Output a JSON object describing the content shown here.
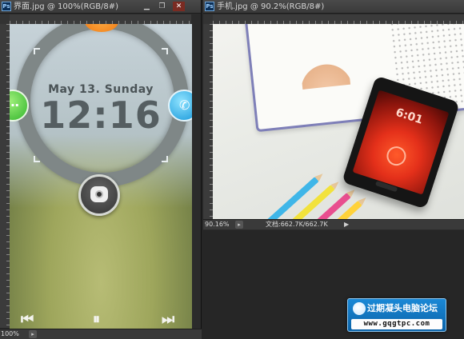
{
  "left_window": {
    "ps_badge": "Ps",
    "title": "界面.jpg @ 100%(RGB/8#)",
    "btn_minimize": "▁",
    "btn_restore": "❐",
    "btn_close": "✕",
    "lock_screen": {
      "date": "May 13.  Sunday",
      "time": "12:16",
      "media_prev": "⏮",
      "media_pause": "⏸",
      "media_next": "⏭"
    },
    "status": {
      "zoom": "100%",
      "nav_icon": "▸"
    }
  },
  "right_window": {
    "ps_badge": "Ps",
    "title": "手机.jpg @ 90.2%(RGB/8#)",
    "phone_time": "6:01",
    "status": {
      "zoom": "90.16%",
      "nav_icon": "▸",
      "doc_info": "文档:662.7K/662.7K",
      "arrow": "▶"
    }
  },
  "watermark": {
    "title": "过期凝头电脑论坛",
    "url": "www.gqgtpc.com"
  },
  "colors": {
    "ps_background": "#262626",
    "titlebar": "#3f3f3f",
    "watermark_blue": "#1a88d6",
    "phone_screen_red": "#e4301a",
    "notebook_border": "#7e7fb8"
  }
}
